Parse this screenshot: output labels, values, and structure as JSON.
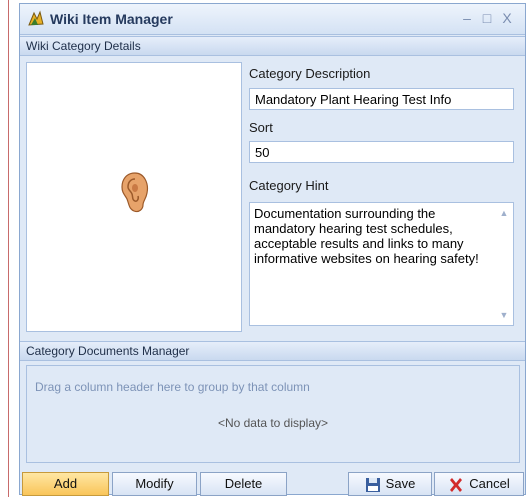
{
  "window": {
    "title": "Wiki Item Manager",
    "controls": {
      "minimize": "–",
      "maximize": "□",
      "close": "X"
    }
  },
  "details_section": {
    "header": "Wiki Category Details",
    "image_icon": "ear-icon",
    "description": {
      "label": "Category Description",
      "value": "Mandatory Plant Hearing Test Info"
    },
    "sort": {
      "label": "Sort",
      "value": "50"
    },
    "hint": {
      "label": "Category Hint",
      "value": "Documentation surrounding the mandatory hearing test schedules, acceptable results and links to many informative websites on hearing safety!"
    }
  },
  "documents_section": {
    "header": "Category Documents Manager",
    "group_hint": "Drag a column header here to group by that column",
    "no_data": "<No data to display>"
  },
  "buttons": {
    "add": "Add",
    "modify": "Modify",
    "delete": "Delete",
    "save": "Save",
    "cancel": "Cancel"
  },
  "colors": {
    "accent": "#dfe9f6",
    "add_button": "#f9c55a",
    "cancel_x": "#d22b2b",
    "save_icon": "#3a5f9e"
  }
}
